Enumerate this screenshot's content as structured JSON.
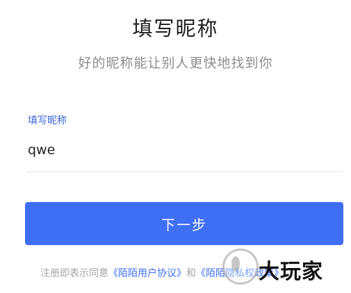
{
  "header": {
    "title": "填写昵称",
    "subtitle": "好的昵称能让别人更快地找到你"
  },
  "form": {
    "label": "填写昵称",
    "nickname_value": "qwe"
  },
  "next_button": {
    "label": "下一步"
  },
  "agreement": {
    "prefix": "注册即表示同意",
    "user_agreement": "《陌陌用户协议》",
    "conjunction": "和",
    "privacy_policy": "《陌陌隐私权政策》"
  },
  "watermark": {
    "text": "大玩家"
  },
  "colors": {
    "accent": "#3f6ff5",
    "label": "#3a63d6",
    "subtitle": "#8d8d8d"
  }
}
